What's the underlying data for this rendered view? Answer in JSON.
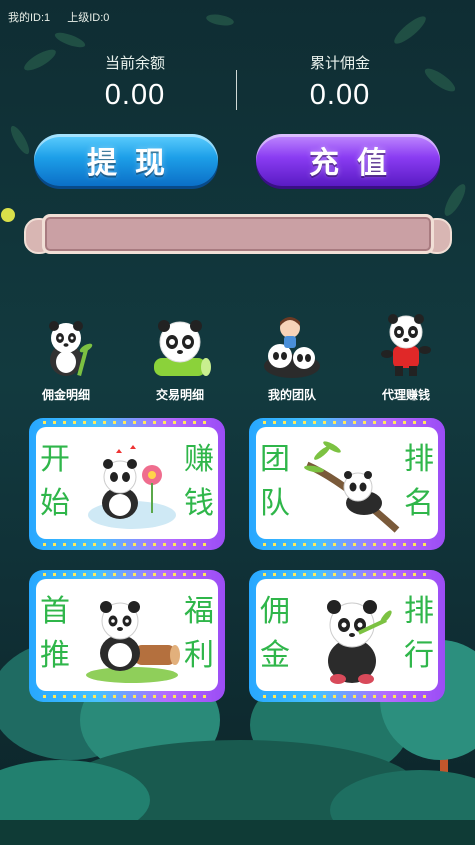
{
  "top_bar": {
    "my_id": "我的ID:1",
    "parent_id": "上级ID:0"
  },
  "stats": {
    "balance": {
      "label": "当前余额",
      "value": "0.00"
    },
    "commission": {
      "label": "累计佣金",
      "value": "0.00"
    }
  },
  "buttons": {
    "withdraw": "提现",
    "recharge": "充值"
  },
  "menu": [
    {
      "label": "佣金明细",
      "icon": "panda-bamboo-icon"
    },
    {
      "label": "交易明细",
      "icon": "panda-log-icon"
    },
    {
      "label": "我的团队",
      "icon": "panda-team-icon"
    },
    {
      "label": "代理赚钱",
      "icon": "panda-shirt-icon"
    }
  ],
  "cards": [
    {
      "left": [
        "开",
        "始"
      ],
      "right": [
        "赚",
        "钱"
      ],
      "art": "panda-flower-icon"
    },
    {
      "left": [
        "团",
        "队"
      ],
      "right": [
        "排",
        "名"
      ],
      "art": "panda-branch-icon"
    },
    {
      "left": [
        "首",
        "推"
      ],
      "right": [
        "福",
        "利"
      ],
      "art": "panda-log-sit-icon"
    },
    {
      "left": [
        "佣",
        "金"
      ],
      "right": [
        "排",
        "行"
      ],
      "art": "panda-bamboo-eat-icon"
    }
  ],
  "colors": {
    "blue_button": "#1d9fe8",
    "purple_button": "#8a3cf2",
    "card_text": "#2fb64a",
    "banner": "#caa0a4"
  }
}
